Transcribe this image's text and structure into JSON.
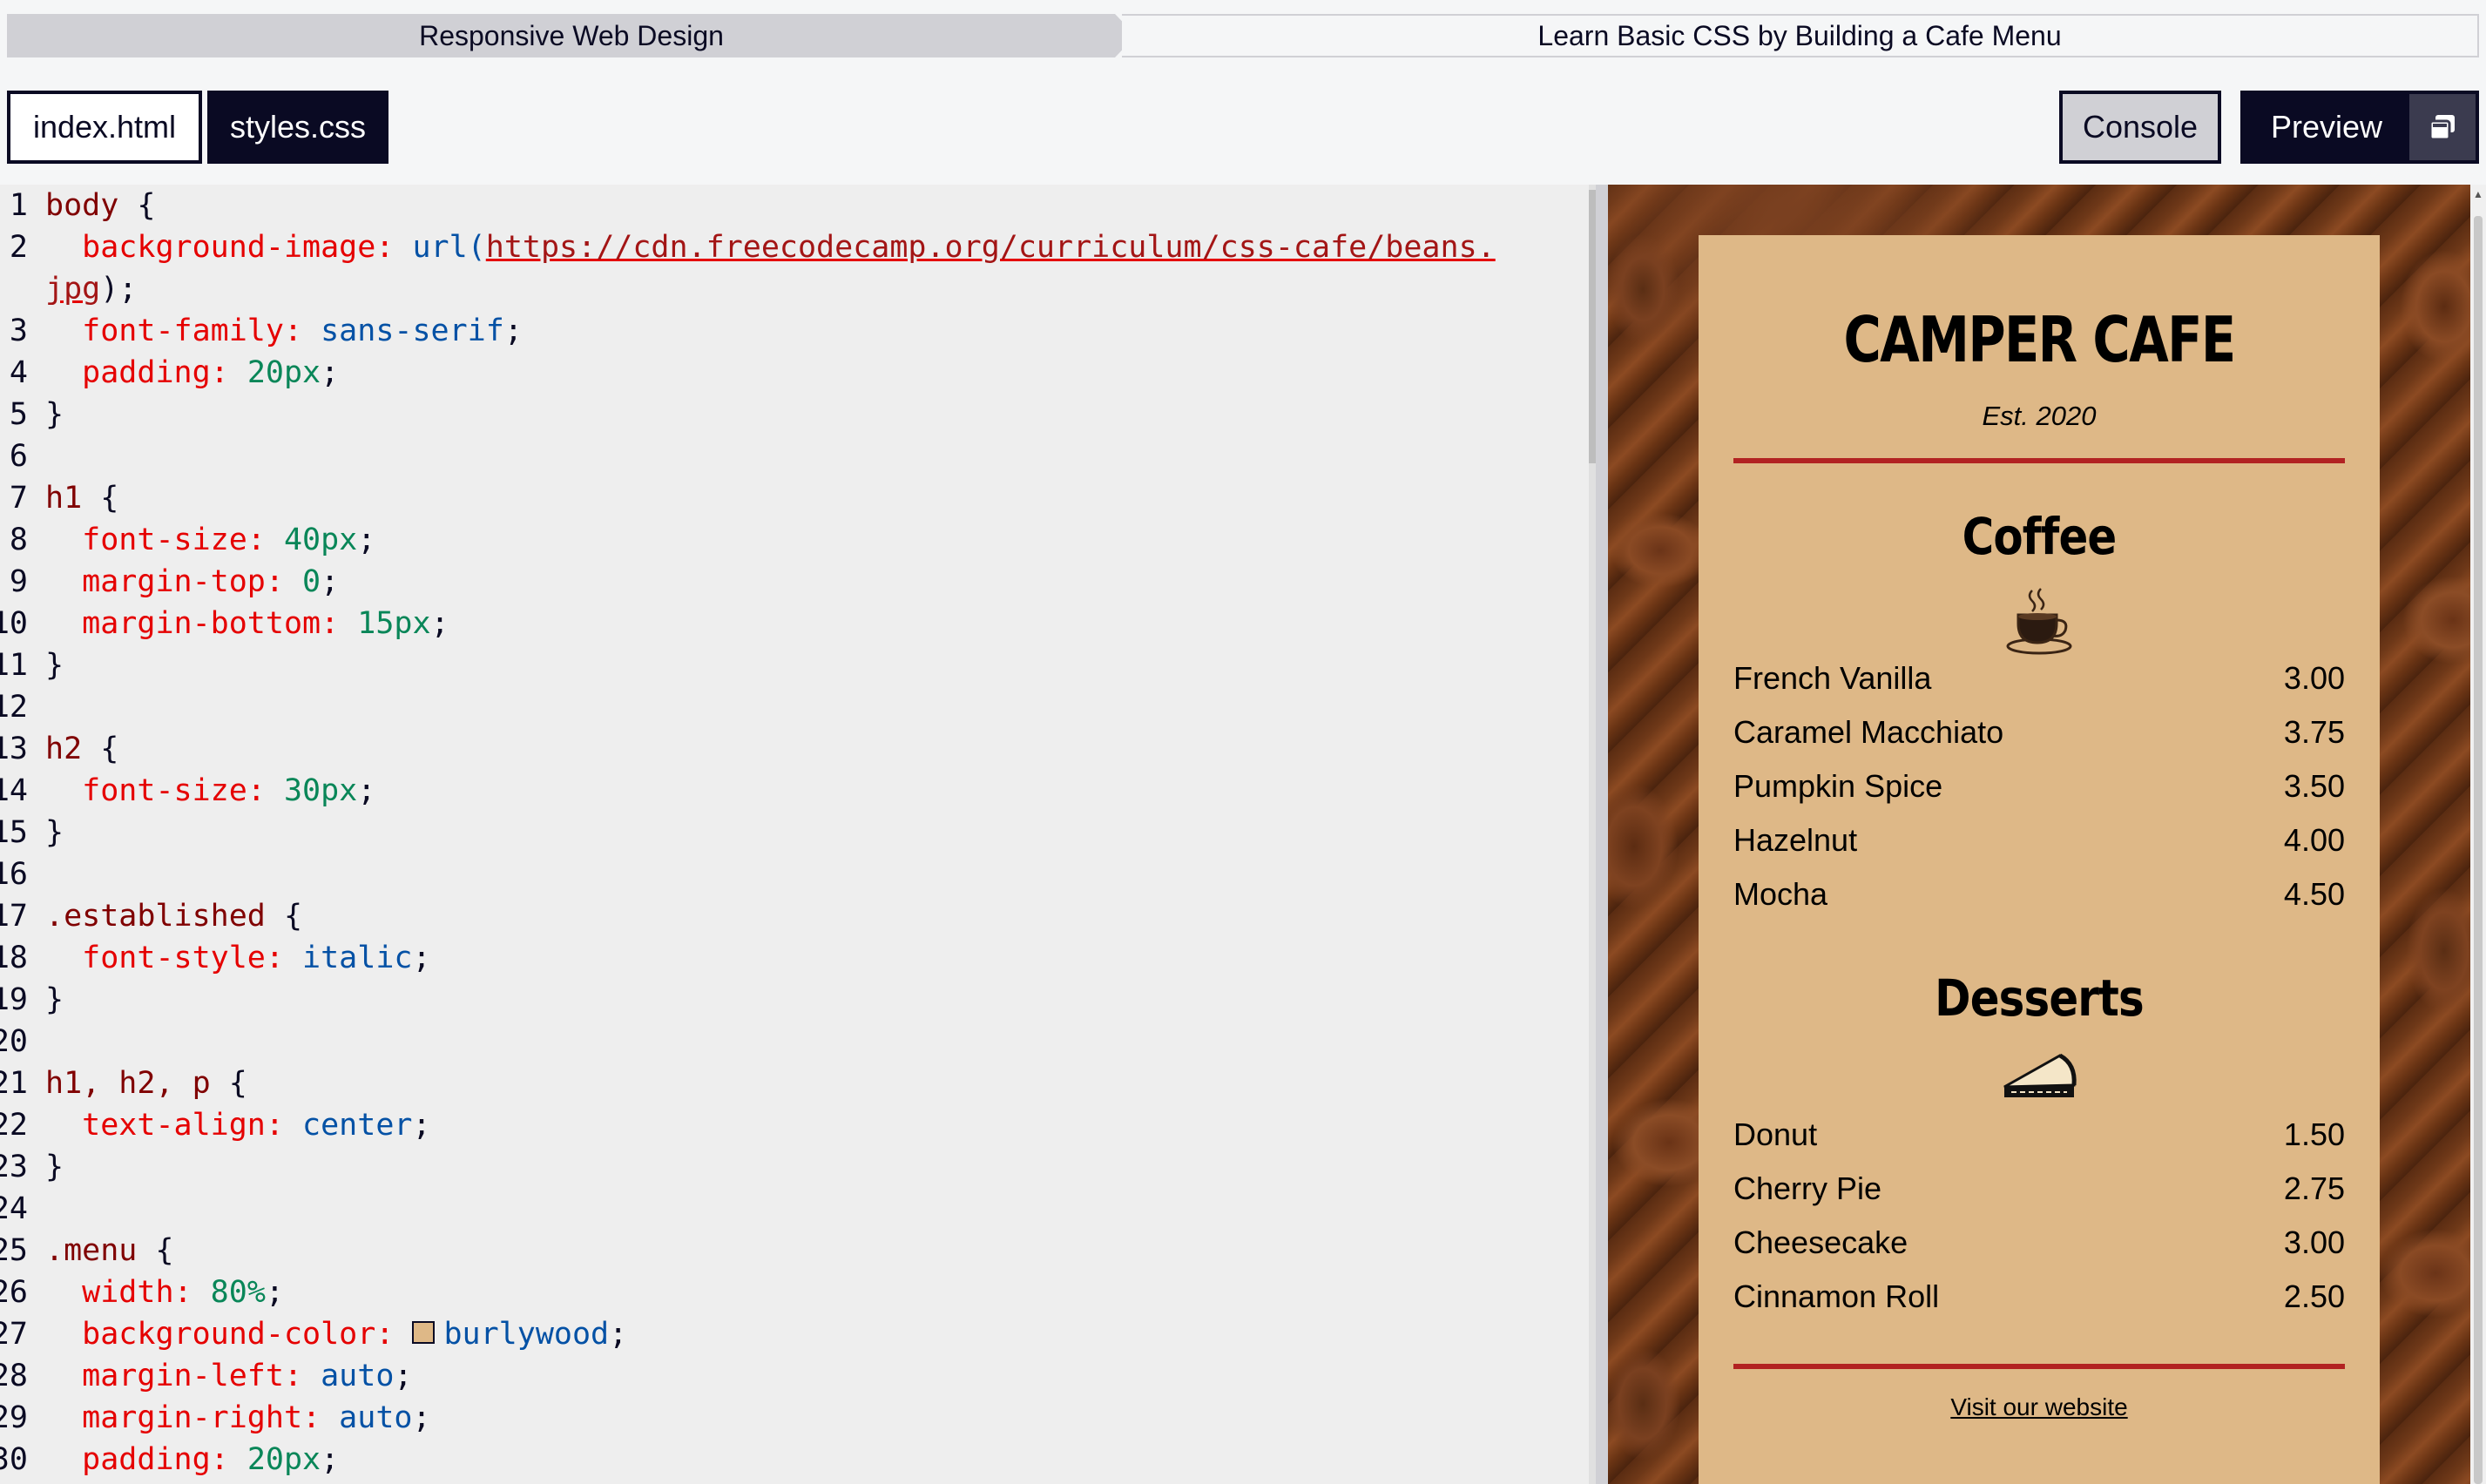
{
  "breadcrumb": {
    "course": "Responsive Web Design",
    "project": "Learn Basic CSS by Building a Cafe Menu"
  },
  "tabs": {
    "index": "index.html",
    "styles": "styles.css"
  },
  "actions": {
    "console": "Console",
    "preview": "Preview",
    "preview_icon": "popout-window-icon"
  },
  "editor": {
    "lines": [
      {
        "n": "1"
      },
      {
        "n": "2"
      },
      {
        "n": ""
      },
      {
        "n": "3"
      },
      {
        "n": "4"
      },
      {
        "n": "5"
      },
      {
        "n": "6"
      },
      {
        "n": "7"
      },
      {
        "n": "8"
      },
      {
        "n": "9"
      },
      {
        "n": "10"
      },
      {
        "n": "11"
      },
      {
        "n": "12"
      },
      {
        "n": "13"
      },
      {
        "n": "14"
      },
      {
        "n": "15"
      },
      {
        "n": "16"
      },
      {
        "n": "17"
      },
      {
        "n": "18"
      },
      {
        "n": "19"
      },
      {
        "n": "20"
      },
      {
        "n": "21"
      },
      {
        "n": "22"
      },
      {
        "n": "23"
      },
      {
        "n": "24"
      },
      {
        "n": "25"
      },
      {
        "n": "26"
      },
      {
        "n": "27"
      },
      {
        "n": "28"
      },
      {
        "n": "29"
      },
      {
        "n": "30"
      }
    ],
    "tokens": {
      "body_sel": "body",
      "bg_image_prop": "background-image:",
      "url_fn": "url(",
      "url_1": "https://cdn.freecodecamp.org/curriculum/css-cafe/beans.",
      "url_2": "jpg",
      "url_end": ");",
      "font_family_prop": "font-family:",
      "sans_serif": "sans-serif",
      "padding_prop": "padding:",
      "px20": "20px",
      "h1_sel": "h1",
      "font_size_prop": "font-size:",
      "px40": "40px",
      "margin_top_prop": "margin-top:",
      "zero": "0",
      "margin_bottom_prop": "margin-bottom:",
      "px15": "15px",
      "h2_sel": "h2",
      "px30": "30px",
      "established_sel": ".established",
      "font_style_prop": "font-style:",
      "italic": "italic",
      "h1h2p_sel": "h1, h2, p",
      "text_align_prop": "text-align:",
      "center": "center",
      "menu_sel": ".menu",
      "width_prop": "width:",
      "pct80": "80%",
      "bg_color_prop": "background-color:",
      "burlywood": "burlywood",
      "margin_left_prop": "margin-left:",
      "auto": "auto",
      "margin_right_prop": "margin-right:",
      "open_brace": " {",
      "close_brace": "}",
      "semi": ";"
    },
    "swatch_color": "#deb887"
  },
  "preview": {
    "title": "CAMPER CAFE",
    "established": "Est. 2020",
    "coffee_heading": "Coffee",
    "coffee_icon": "coffee-cup-icon",
    "coffee_items": [
      {
        "name": "French Vanilla",
        "price": "3.00"
      },
      {
        "name": "Caramel Macchiato",
        "price": "3.75"
      },
      {
        "name": "Pumpkin Spice",
        "price": "3.50"
      },
      {
        "name": "Hazelnut",
        "price": "4.00"
      },
      {
        "name": "Mocha",
        "price": "4.50"
      }
    ],
    "desserts_heading": "Desserts",
    "dessert_icon": "pie-slice-icon",
    "dessert_items": [
      {
        "name": "Donut",
        "price": "1.50"
      },
      {
        "name": "Cherry Pie",
        "price": "2.75"
      },
      {
        "name": "Cheesecake",
        "price": "3.00"
      },
      {
        "name": "Cinnamon Roll",
        "price": "2.50"
      }
    ],
    "footer_link": "Visit our website",
    "menu_bg": "#deb887",
    "rule_color": "#b22222"
  }
}
